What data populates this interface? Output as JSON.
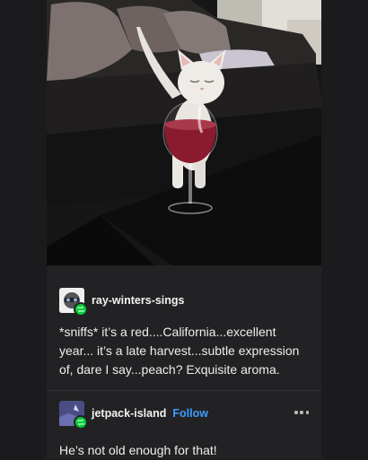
{
  "post": {
    "image_alt": "",
    "reblogs": [
      {
        "username": "ray-winters-sings",
        "text": "*sniffs* it’s a red....California...excellent year... it’s a late harvest...subtle expression of, dare I say...peach? Exquisite aroma."
      },
      {
        "username": "jetpack-island",
        "follow_label": "Follow",
        "text": "He’s not old enough for that!"
      }
    ]
  },
  "icons": {
    "reblog_badge": "reblog-icon",
    "more": "more-options-icon"
  },
  "colors": {
    "background": "#1b1b1d",
    "card": "#222224",
    "follow": "#3c9cff",
    "reblog_badge": "#01cf35"
  }
}
